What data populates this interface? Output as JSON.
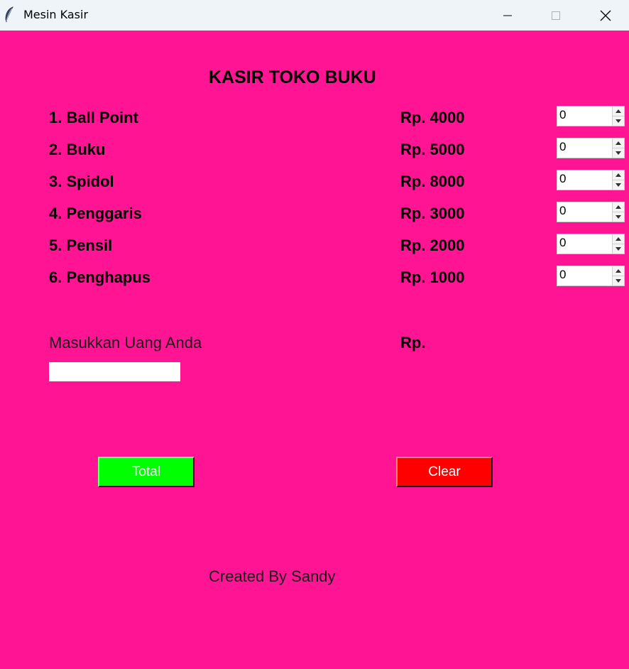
{
  "window": {
    "title": "Mesin Kasir",
    "icon": "feather-icon",
    "background": "#ff1493"
  },
  "heading": "KASIR TOKO BUKU",
  "items": [
    {
      "name": "1. Ball Point",
      "price": "Rp. 4000",
      "qty": "0"
    },
    {
      "name": "2. Buku",
      "price": "Rp. 5000",
      "qty": "0"
    },
    {
      "name": "3. Spidol",
      "price": "Rp. 8000",
      "qty": "0"
    },
    {
      "name": "4. Penggaris",
      "price": "Rp. 3000",
      "qty": "0"
    },
    {
      "name": "5. Pensil",
      "price": "Rp. 2000",
      "qty": "0"
    },
    {
      "name": "6. Penghapus",
      "price": "Rp. 1000",
      "qty": "0"
    }
  ],
  "money": {
    "label": "Masukkan Uang Anda",
    "currency_label": "Rp.",
    "value": ""
  },
  "buttons": {
    "total": {
      "label": "Total",
      "color": "#00ff00"
    },
    "clear": {
      "label": "Clear",
      "color": "#ff0000"
    }
  },
  "footer": "Created By Sandy"
}
